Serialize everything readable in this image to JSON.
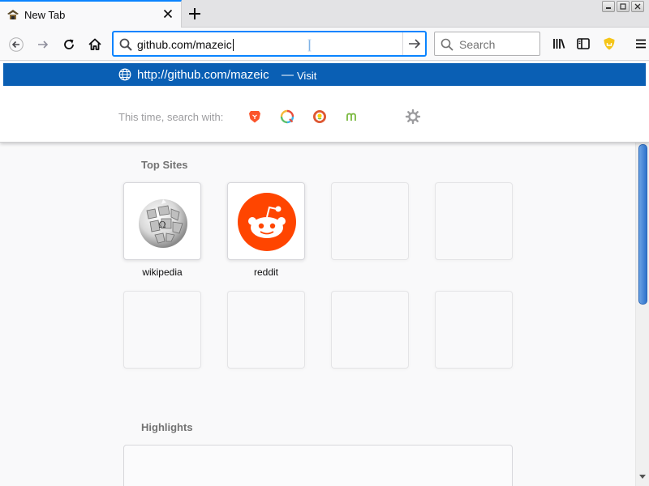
{
  "tab": {
    "title": "New Tab"
  },
  "urlbar": {
    "value": "github.com/mazeic"
  },
  "searchbar": {
    "placeholder": "Search"
  },
  "dropdown": {
    "url": "http://github.com/mazeic",
    "separator": "—",
    "action": "Visit",
    "oneoff_label": "This time, search with:",
    "engines": [
      "Brave",
      "Qwant",
      "DuckDuckGo",
      "Mojeek"
    ]
  },
  "top_sites": {
    "title": "Top Sites",
    "tiles": [
      {
        "label": "wikipedia",
        "icon": "wikipedia-globe-icon"
      },
      {
        "label": "reddit",
        "icon": "reddit-alien-icon"
      }
    ]
  },
  "highlights": {
    "title": "Highlights"
  },
  "colors": {
    "accent": "#0a84ff",
    "selection": "#0a5fb4",
    "reddit": "#ff4500"
  }
}
